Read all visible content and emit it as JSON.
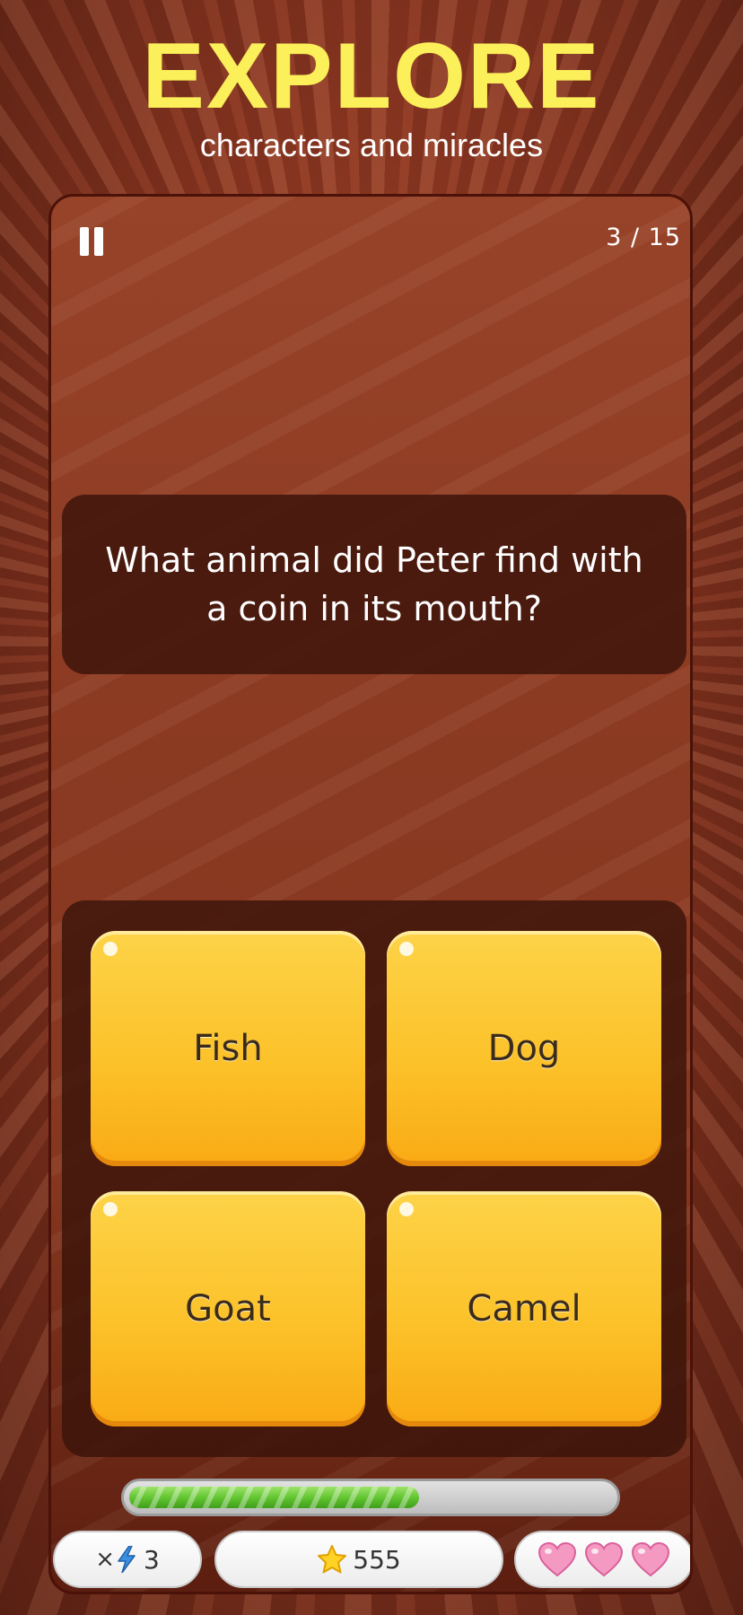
{
  "header": {
    "title": "EXPLORE",
    "subtitle": "characters and miracles"
  },
  "game": {
    "counter": "3 / 15",
    "question": "What animal did Peter find with a coin in its mouth?",
    "answers": [
      "Fish",
      "Dog",
      "Goat",
      "Camel"
    ],
    "progress": 0.6,
    "boost_prefix": "×",
    "boost_count": "3",
    "stars": "555",
    "lives": 3
  },
  "icons": {
    "pause": "pause-icon",
    "boost": "lightning-bolt-icon",
    "star": "star-icon",
    "heart": "heart-icon"
  },
  "colors": {
    "title": "#fbef5a",
    "answer_button": "#fcc22a",
    "progress_fill": "#5fc22e",
    "heart": "#f49ac2"
  }
}
